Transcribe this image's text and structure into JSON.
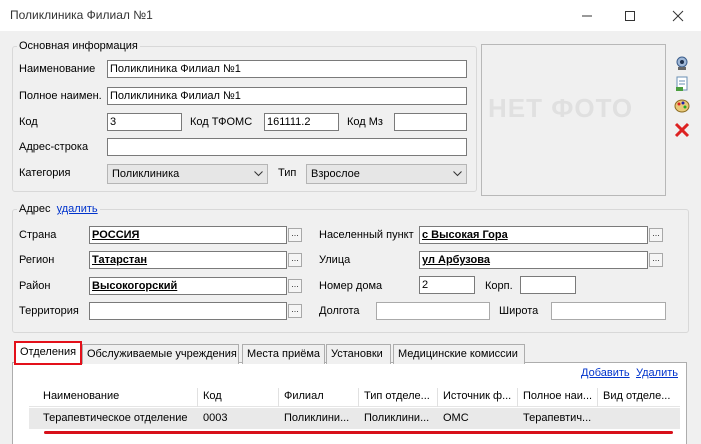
{
  "window": {
    "title": "Поликлиника Филиал №1"
  },
  "main_info": {
    "legend": "Основная информация",
    "name_label": "Наименование",
    "name_value": "Поликлиника Филиал №1",
    "fullname_label": "Полное наимен.",
    "fullname_value": "Поликлиника Филиал №1",
    "code_label": "Код",
    "code_value": "3",
    "tfoms_label": "Код ТФОМС",
    "tfoms_value": "161111.2",
    "mz_label": "Код Мз",
    "mz_value": "",
    "address_line_label": "Адрес-строка",
    "address_line_value": "",
    "category_label": "Категория",
    "category_value": "Поликлиника",
    "type_label": "Тип",
    "type_value": "Взрослое",
    "photo_placeholder": "НЕТ ФОТО"
  },
  "address": {
    "legend": "Адрес",
    "delete_link": "удалить",
    "country_label": "Страна",
    "country_value": "РОССИЯ",
    "region_label": "Регион",
    "region_value": "Татарстан",
    "district_label": "Район",
    "district_value": "Высокогорский",
    "territory_label": "Территория",
    "territory_value": "",
    "locality_label": "Населенный пункт",
    "locality_value": "с Высокая Гора",
    "street_label": "Улица",
    "street_value": "ул Арбузова",
    "house_label": "Номер дома",
    "house_value": "2",
    "building_label": "Корп.",
    "building_value": "",
    "longitude_label": "Долгота",
    "longitude_value": "",
    "latitude_label": "Широта",
    "latitude_value": "",
    "dots": "..."
  },
  "tabs": [
    {
      "label": "Отделения"
    },
    {
      "label": "Обслуживаемые учреждения"
    },
    {
      "label": "Места приёма"
    },
    {
      "label": "Установки"
    },
    {
      "label": "Медицинские комиссии"
    }
  ],
  "grid": {
    "add_link": "Добавить",
    "delete_link": "Удалить",
    "columns": [
      "Наименование",
      "Код",
      "Филиал",
      "Тип отделе...",
      "Источник ф...",
      "Полное наи...",
      "Вид отделе..."
    ],
    "rows": [
      [
        "Терапевтическое отделение",
        "0003",
        "Поликлини...",
        "Поликлини...",
        "ОМС",
        "Терапевтич...",
        ""
      ]
    ]
  },
  "colors": {
    "highlight": "#e3101a",
    "link": "#0033cc"
  }
}
